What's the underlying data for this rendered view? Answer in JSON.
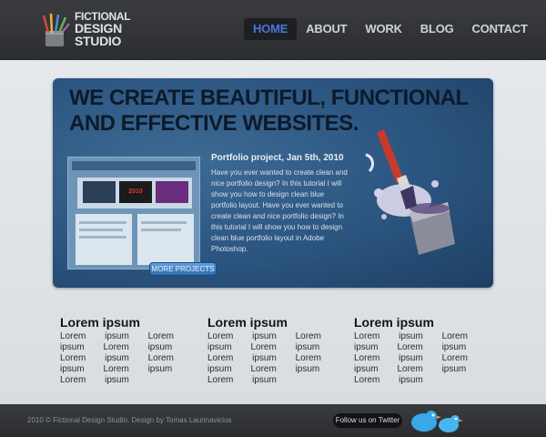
{
  "brand": {
    "line1": "FICTIONAL",
    "line2": "DESIGN",
    "line3": "STUDIO"
  },
  "nav": {
    "items": [
      "HOME",
      "ABOUT",
      "WORK",
      "BLOG",
      "CONTACT"
    ],
    "active_color": "#4b74d8"
  },
  "hero": {
    "headline_line1": "WE CREATE BEAUTIFUL, FUNCTIONAL",
    "headline_line2": "AND EFFECTIVE WEBSITES.",
    "project_title": "Portfolio project, Jan 5th, 2010",
    "project_text": "Have you ever wanted to create clean and nice portfolio design? In this tutorial I will show you how to design clean blue portfolio layout. Have you ever wanted to create clean and nice portfolio design? In this tutorial I will show you how to design clean blue portfolio layout in Adobe Photoshop.",
    "more_button": "MORE PROJECTS",
    "thumbnail_text": "2010"
  },
  "columns": [
    {
      "title": "Lorem ipsum",
      "text": "Lorem ipsum Lorem ipsum Lorem ipsum Lorem ipsum Lorem ipsum Lorem ipsum Lorem ipsum"
    },
    {
      "title": "Lorem ipsum",
      "text": "Lorem ipsum Lorem ipsum Lorem ipsum Lorem ipsum Lorem ipsum Lorem ipsum Lorem ipsum"
    },
    {
      "title": "Lorem ipsum",
      "text": "Lorem ipsum Lorem ipsum Lorem ipsum Lorem ipsum Lorem ipsum Lorem ipsum Lorem ipsum"
    }
  ],
  "footer": {
    "copyright": "2010 © Fictional Design Studio. Design by Tomas Laurinavicius",
    "twitter_button": "Follow us on Twitter"
  },
  "icons": {
    "logo": "brushes-cup-icon",
    "hero_art": "paintbrush-bucket-icon",
    "footer_birds": "twitter-birds-icon"
  }
}
